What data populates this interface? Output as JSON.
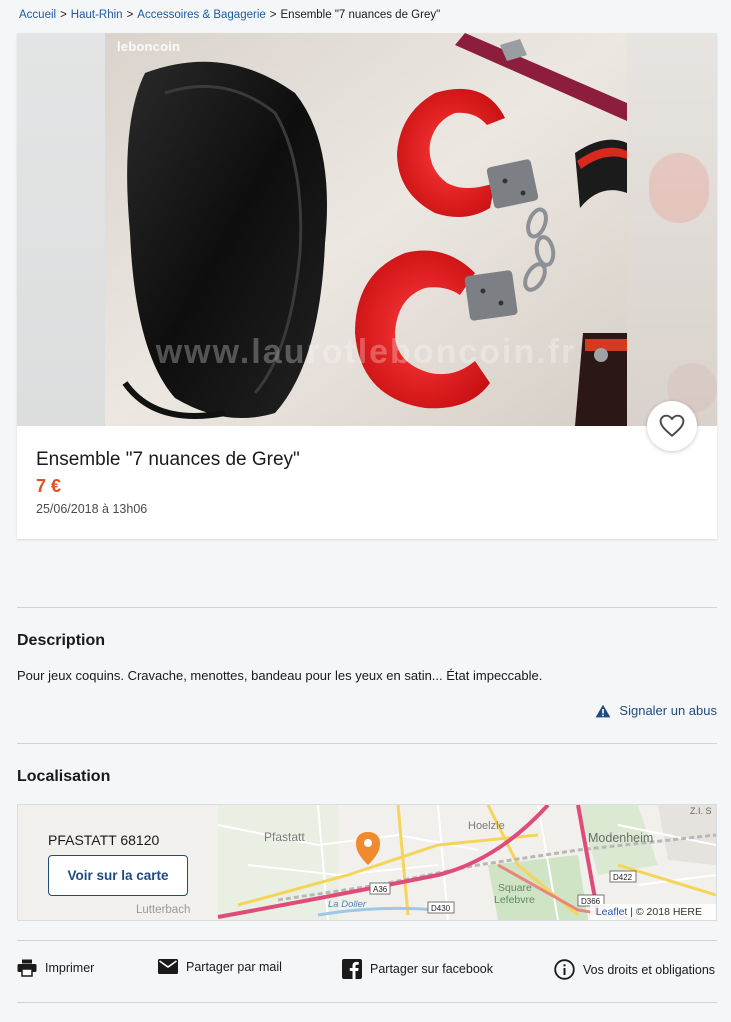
{
  "breadcrumb": {
    "items": [
      "Accueil",
      "Haut-Rhin",
      "Accessoires & Bagagerie"
    ],
    "current": "Ensemble \"7 nuances de Grey\"",
    "separator": ">"
  },
  "gallery": {
    "logo_text": "leboncoin",
    "watermark_text": "www.laurotleboncoin.fr"
  },
  "ad": {
    "title": "Ensemble \"7 nuances de Grey\"",
    "price": "7 €",
    "date": "25/06/2018 à 13h06"
  },
  "description": {
    "heading": "Description",
    "text": "Pour jeux coquins. Cravache, menottes, bandeau pour les yeux en satin... État impeccable.",
    "report_label": "Signaler un abus"
  },
  "location": {
    "heading": "Localisation",
    "city": "PFASTATT 68120",
    "map_button": "Voir sur la carte",
    "map_labels": {
      "pfastatt": "Pfastatt",
      "hoelzle": "Hoelzle",
      "modenheim": "Modenheim",
      "lutterbach": "Lutterbach",
      "square": "Square",
      "lefebvre": "Lefebvre",
      "la_doller": "La Doller",
      "a36": "A36",
      "d430": "D430",
      "d366": "D366",
      "d422": "D422",
      "zi": "Z.I. S"
    },
    "credit_leaflet": "Leaflet",
    "credit_sep": " | ",
    "credit_here": "© 2018 HERE"
  },
  "actions": {
    "print": "Imprimer",
    "mail": "Partager par mail",
    "facebook": "Partager sur facebook",
    "rights": "Vos droits et obligations"
  },
  "colors": {
    "price": "#e35120",
    "link": "#1f5aa3",
    "accent": "#1f4b80",
    "map_pin": "#f18a2f"
  }
}
